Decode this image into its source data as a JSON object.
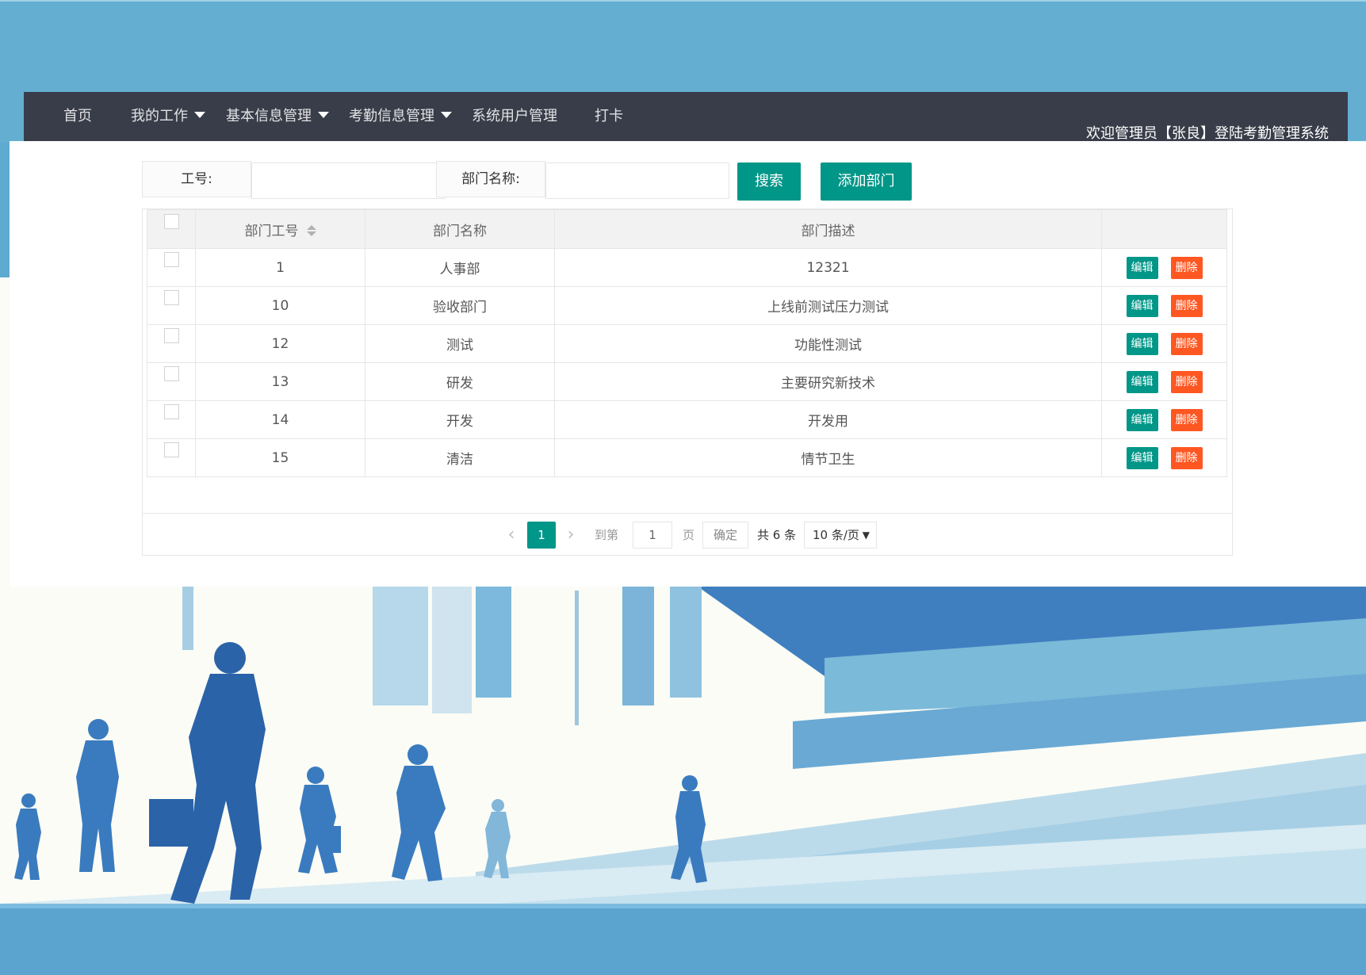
{
  "nav": {
    "items": [
      {
        "label": "首页",
        "dropdown": false
      },
      {
        "label": "我的工作",
        "dropdown": true
      },
      {
        "label": "基本信息管理",
        "dropdown": true
      },
      {
        "label": "考勤信息管理",
        "dropdown": true
      },
      {
        "label": "系统用户管理",
        "dropdown": false
      },
      {
        "label": "打卡",
        "dropdown": false
      }
    ],
    "welcome": "欢迎管理员【张良】登陆考勤管理系统"
  },
  "search": {
    "emp_no_label": "工号:",
    "emp_no_value": "",
    "dept_name_label": "部门名称:",
    "dept_name_value": "",
    "search_button": "搜索",
    "add_button": "添加部门"
  },
  "table": {
    "headers": {
      "id": "部门工号",
      "name": "部门名称",
      "desc": "部门描述"
    },
    "rows": [
      {
        "id": "1",
        "name": "人事部",
        "desc": "12321"
      },
      {
        "id": "10",
        "name": "验收部门",
        "desc": "上线前测试压力测试"
      },
      {
        "id": "12",
        "name": "测试",
        "desc": "功能性测试"
      },
      {
        "id": "13",
        "name": "研发",
        "desc": "主要研究新技术"
      },
      {
        "id": "14",
        "name": "开发",
        "desc": "开发用"
      },
      {
        "id": "15",
        "name": "清洁",
        "desc": "情节卫生"
      }
    ],
    "edit_label": "编辑",
    "delete_label": "删除"
  },
  "pagination": {
    "current_page": "1",
    "goto_label": "到第",
    "goto_value": "1",
    "page_unit": "页",
    "confirm": "确定",
    "total": "共 6 条",
    "page_size": "10 条/页"
  },
  "colors": {
    "primary": "#009688",
    "danger": "#ff5722",
    "navbar": "#393d49",
    "sky": "#64afd1"
  },
  "icons": {
    "sort": "sort-icon",
    "prev": "chevron-left-icon",
    "next": "chevron-right-icon",
    "caret": "caret-down-icon"
  }
}
